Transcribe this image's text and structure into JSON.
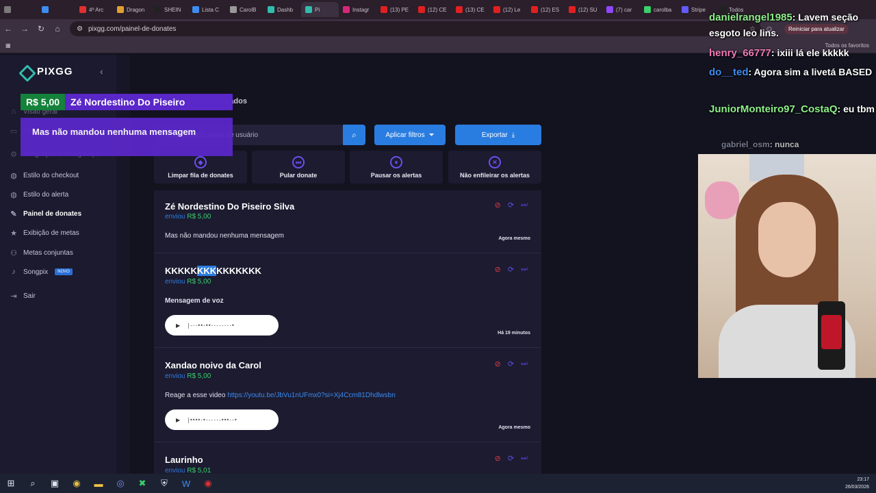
{
  "browser": {
    "tabs": [
      {
        "label": "",
        "color": "#7a7a7a"
      },
      {
        "label": "",
        "color": "#3d8cf0"
      },
      {
        "label": "4º Arc",
        "color": "#e03030"
      },
      {
        "label": "Dragon",
        "color": "#e0a030"
      },
      {
        "label": "SHEIN",
        "color": "#222222"
      },
      {
        "label": "Lista C",
        "color": "#3d8cf0"
      },
      {
        "label": "CarolB",
        "color": "#999999"
      },
      {
        "label": "Dashb",
        "color": "#32bcad"
      },
      {
        "label": "Pi",
        "color": "#32bcad",
        "active": true
      },
      {
        "label": "Instagr",
        "color": "#d6287a"
      },
      {
        "label": "(13) PE",
        "color": "#e02020"
      },
      {
        "label": "(12) CE",
        "color": "#e02020"
      },
      {
        "label": "(13) CE",
        "color": "#e02020"
      },
      {
        "label": "(12) Le",
        "color": "#e02020"
      },
      {
        "label": "(12) ES",
        "color": "#e02020"
      },
      {
        "label": "(12) SU",
        "color": "#e02020"
      },
      {
        "label": "(7) car",
        "color": "#9146ff"
      },
      {
        "label": "carolba",
        "color": "#39d16b"
      },
      {
        "label": "Stripe",
        "color": "#635bff"
      },
      {
        "label": "Todos",
        "color": "#222222"
      }
    ],
    "url": "pixgg.com/painel-de-donates",
    "reload_label": "Reiniciar para atualizar",
    "all_bookmarks": "Todos os favoritos"
  },
  "sidebar": {
    "logo": "PIXGG",
    "items": [
      {
        "label": "Visão geral",
        "icon": "home-icon",
        "glyph": "⌂"
      },
      {
        "label": "Financeiro",
        "icon": "wallet-icon",
        "glyph": "▭"
      },
      {
        "label": "Integração e configuração",
        "icon": "gear-icon",
        "glyph": "⚙"
      },
      {
        "label": "Estilo do checkout",
        "icon": "palette-icon",
        "glyph": "◍"
      },
      {
        "label": "Estilo do alerta",
        "icon": "palette-icon",
        "glyph": "◍"
      },
      {
        "label": "Painel de donates",
        "icon": "donate-icon",
        "glyph": "✎",
        "active": true
      },
      {
        "label": "Exibição de metas",
        "icon": "star-icon",
        "glyph": "★"
      },
      {
        "label": "Metas conjuntas",
        "icon": "users-icon",
        "glyph": "⚇"
      },
      {
        "label": "Songpix",
        "icon": "music-icon",
        "glyph": "♪",
        "badge": "NOVO"
      },
      {
        "label": "Sair",
        "icon": "logout-icon",
        "glyph": "⇥"
      }
    ]
  },
  "main": {
    "tab_blocked": "Bloqueados",
    "search_placeholder": "Pesquise pelo nome de usuário",
    "apply_filters": "Aplicar filtros",
    "export": "Exportar",
    "actions": [
      {
        "label": "Limpar fila de donates",
        "glyph": "◆"
      },
      {
        "label": "Pular donate",
        "glyph": "⏭"
      },
      {
        "label": "Pausar os alertas",
        "glyph": "⏸"
      },
      {
        "label": "Não enfileirar os alertas",
        "glyph": "✕"
      }
    ],
    "donates": [
      {
        "name": "Zé Nordestino Do Piseiro Silva",
        "sent": "enviou",
        "amount": "R$ 5,00",
        "message": "Mas não mandou nenhuma mensagem",
        "time": "Agora mesmo"
      },
      {
        "name_a": "KKKKK",
        "name_b": "KKK",
        "name_c": "KKKKKKK",
        "sent": "enviou",
        "amount": "R$ 5,00",
        "message": "Mensagem de voz",
        "time": "Há 19 minutos",
        "audio": true
      },
      {
        "name": "Xandao noivo da Carol",
        "sent": "enviou",
        "amount": "R$ 5,00",
        "message": "Reage a esse video",
        "link": "https://youtu.be/JbVu1nUFmx0?si=Xj4Ccm81Dhdlwsbn",
        "time": "Agora mesmo",
        "audio": true
      },
      {
        "name": "Laurinho",
        "sent": "enviou",
        "amount": "R$ 5,01"
      }
    ]
  },
  "alert_overlay": {
    "amount": "R$ 5,00",
    "name": "Zé Nordestino Do Piseiro",
    "message": "Mas não mandou nenhuma mensagem"
  },
  "chat": [
    {
      "user": "danielrangel1985",
      "text": ": Lavem seção esgoto leo lins.",
      "color": "#8ef08a"
    },
    {
      "user": "henry_66777",
      "text": ": ixiii lá ele kkkkk",
      "color": "#f07ab8"
    },
    {
      "user": "do__ted",
      "text": ": Agora sim a livetá BASED",
      "color": "#3d8cf0"
    },
    {
      "user": "JuniorMonteiro97_CostaQ",
      "text": ": eu tbm",
      "color": "#8ef08a"
    },
    {
      "user": "gabriel_osm",
      "text": ": nunca",
      "color": "#a0a6c0"
    }
  ],
  "taskbar": {
    "time": "23:17",
    "date": "26/03/2026"
  }
}
